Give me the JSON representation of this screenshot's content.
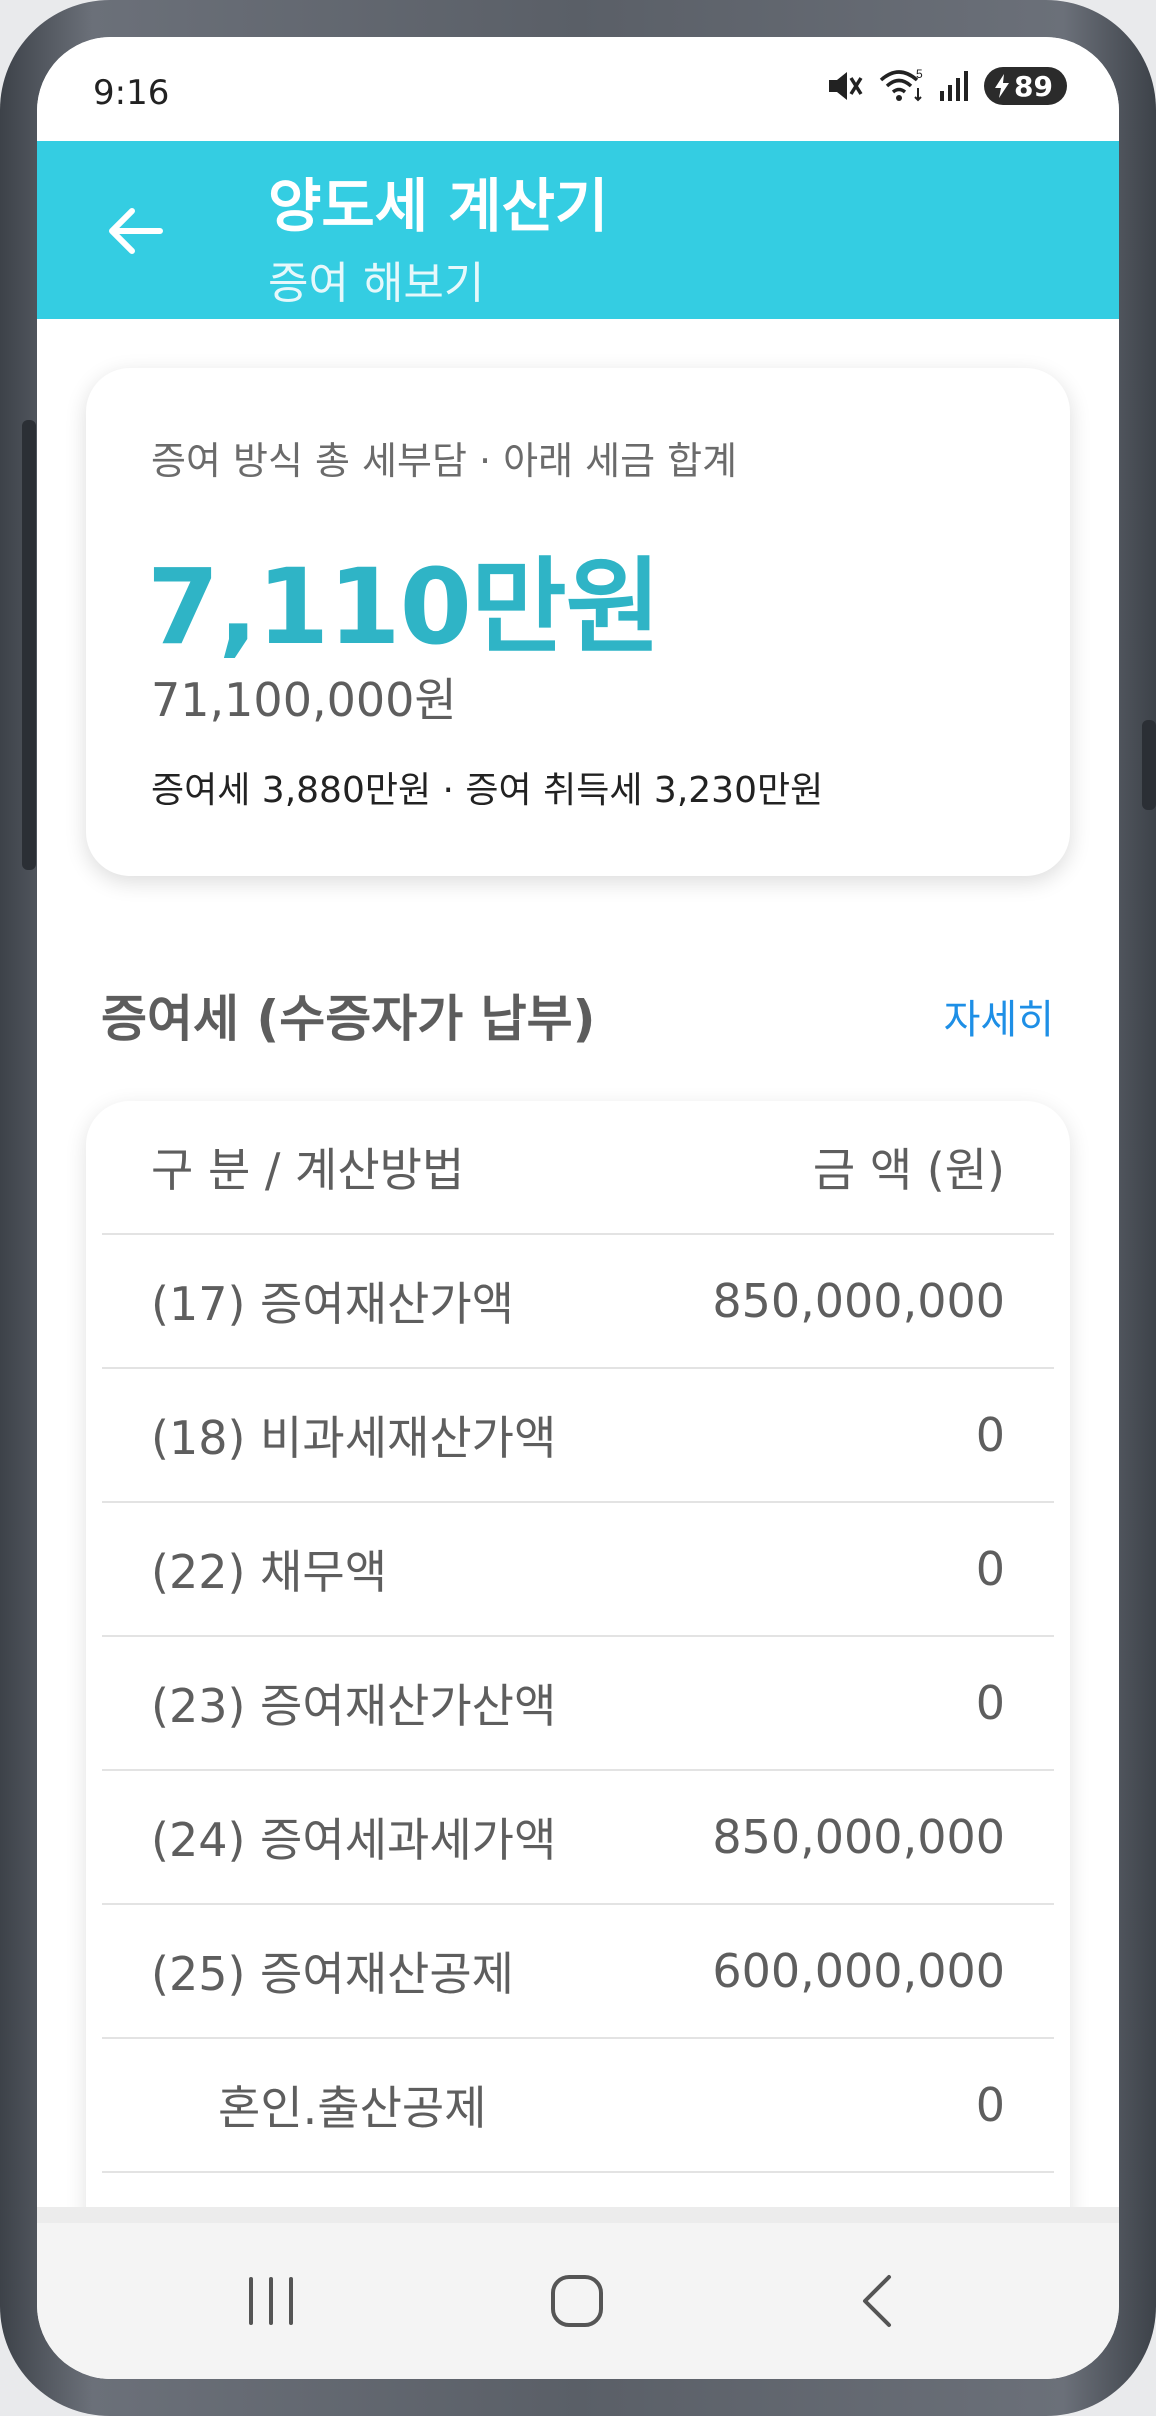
{
  "status_bar": {
    "time": "9:16",
    "battery_level": "89",
    "icons": [
      "mute-icon",
      "wifi-icon",
      "signal-icon",
      "battery-icon"
    ]
  },
  "app_bar": {
    "title": "양도세 계산기",
    "subtitle": "증여 해보기",
    "back_icon": "back-arrow-icon",
    "color": "#34cde2"
  },
  "summary": {
    "label": "증여 방식 총 세부담 · 아래 세금 합계",
    "amount": "7,110만원",
    "amount_won": "71,100,000원",
    "breakdown": "증여세 3,880만원 · 증여 취득세 3,230만원",
    "accent_color": "#2fb4c6"
  },
  "section": {
    "title": "증여세 (수증자가 납부)",
    "detail_link": "자세히",
    "link_color": "#1e8fe6"
  },
  "table": {
    "header": {
      "label": "구 분 / 계산방법",
      "amount": "금 액 (원)"
    },
    "rows": [
      {
        "label": "(17) 증여재산가액",
        "amount": "850,000,000"
      },
      {
        "label": "(18) 비과세재산가액",
        "amount": "0"
      },
      {
        "label": "(22) 채무액",
        "amount": "0"
      },
      {
        "label": "(23) 증여재산가산액",
        "amount": "0"
      },
      {
        "label": "(24) 증여세과세가액",
        "amount": "850,000,000"
      },
      {
        "label": "(25) 증여재산공제",
        "amount": "600,000,000"
      },
      {
        "label": "혼인.출산공제",
        "amount": "0"
      }
    ]
  },
  "nav_bar": {
    "icons": [
      "recent-apps-icon",
      "home-icon",
      "back-icon"
    ]
  }
}
